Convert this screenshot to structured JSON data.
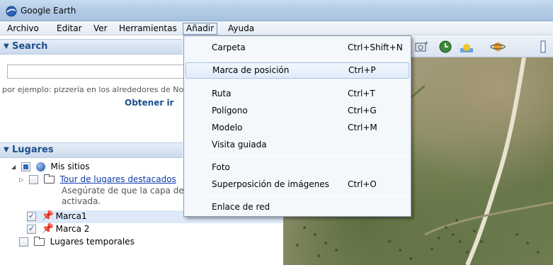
{
  "window": {
    "title": "Google Earth"
  },
  "menubar": [
    {
      "label": "Archivo"
    },
    {
      "label": "Editar"
    },
    {
      "label": "Ver"
    },
    {
      "label": "Herramientas"
    },
    {
      "label": "Añadir"
    },
    {
      "label": "Ayuda"
    }
  ],
  "search": {
    "header": "Search",
    "input_value": "",
    "hint": "por ejemplo: pizzería en los alrededores de No",
    "button_label": "Obtener ir"
  },
  "places": {
    "header": "Lugares",
    "my_places": "Mis sitios",
    "tour": {
      "label": "Tour de lugares destacados",
      "desc_line1": "Asegúrate de que la capa de e",
      "desc_line2": "activada."
    },
    "marca1": "Marca1",
    "marca2": "Marca 2",
    "temporary": "Lugares temporales"
  },
  "add_menu": {
    "items": [
      {
        "label": "Carpeta",
        "shortcut": "Ctrl+Shift+N"
      },
      {
        "label": "Marca de posición",
        "shortcut": "Ctrl+P"
      },
      {
        "label": "Ruta",
        "shortcut": "Ctrl+T"
      },
      {
        "label": "Polígono",
        "shortcut": "Ctrl+G"
      },
      {
        "label": "Modelo",
        "shortcut": "Ctrl+M"
      },
      {
        "label": "Visita guiada",
        "shortcut": ""
      },
      {
        "label": "Foto",
        "shortcut": ""
      },
      {
        "label": "Superposición de imágenes",
        "shortcut": "Ctrl+O"
      },
      {
        "label": "Enlace de red",
        "shortcut": ""
      }
    ]
  },
  "toolbar": {
    "icons": [
      "image-overlay-icon",
      "historical-imagery-icon",
      "sunlight-icon",
      "planets-icon",
      "ruler-icon"
    ]
  }
}
